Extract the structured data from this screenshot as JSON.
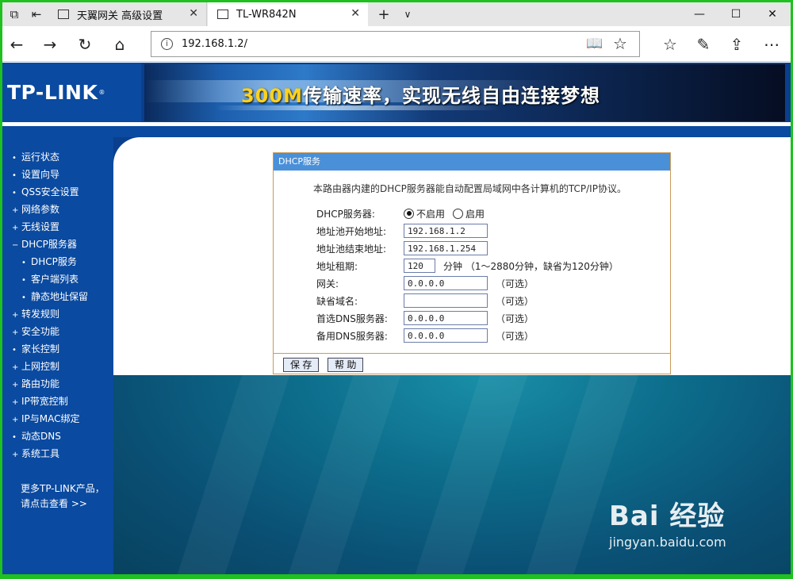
{
  "browser": {
    "tabs": [
      {
        "label": "天翼网关 高级设置"
      },
      {
        "label": "TL-WR842N"
      }
    ],
    "url": "192.168.1.2/"
  },
  "banner": {
    "logo": "TP-LINK",
    "slogan_highlight": "300M",
    "slogan_rest": "传输速率，实现无线自由连接梦想"
  },
  "sidebar": {
    "items": [
      {
        "label": "运行状态",
        "bullet": "•"
      },
      {
        "label": "设置向导",
        "bullet": "•"
      },
      {
        "label": "QSS安全设置",
        "bullet": "•"
      },
      {
        "label": "网络参数",
        "bullet": "+"
      },
      {
        "label": "无线设置",
        "bullet": "+"
      },
      {
        "label": "DHCP服务器",
        "bullet": "−"
      },
      {
        "label": "DHCP服务",
        "bullet": "•"
      },
      {
        "label": "客户端列表",
        "bullet": "•"
      },
      {
        "label": "静态地址保留",
        "bullet": "•"
      },
      {
        "label": "转发规则",
        "bullet": "+"
      },
      {
        "label": "安全功能",
        "bullet": "+"
      },
      {
        "label": "家长控制",
        "bullet": "•"
      },
      {
        "label": "上网控制",
        "bullet": "+"
      },
      {
        "label": "路由功能",
        "bullet": "+"
      },
      {
        "label": "IP带宽控制",
        "bullet": "+"
      },
      {
        "label": "IP与MAC绑定",
        "bullet": "+"
      },
      {
        "label": "动态DNS",
        "bullet": "•"
      },
      {
        "label": "系统工具",
        "bullet": "+"
      }
    ],
    "more_line1": "更多TP-LINK产品，",
    "more_line2": "请点击查看 >>"
  },
  "panel": {
    "title": "DHCP服务",
    "description": "本路由器内建的DHCP服务器能自动配置局域网中各计算机的TCP/IP协议。",
    "server_label": "DHCP服务器:",
    "radio_off": "不启用",
    "radio_on": "启用",
    "selected": "不启用",
    "start_label": "地址池开始地址:",
    "start_value": "192.168.1.2",
    "end_label": "地址池结束地址:",
    "end_value": "192.168.1.254",
    "lease_label": "地址租期:",
    "lease_value": "120",
    "lease_hint": "分钟 （1～2880分钟，缺省为120分钟）",
    "gateway_label": "网关:",
    "gateway_value": "0.0.0.0",
    "domain_label": "缺省域名:",
    "domain_value": "",
    "dns1_label": "首选DNS服务器:",
    "dns1_value": "0.0.0.0",
    "dns2_label": "备用DNS服务器:",
    "dns2_value": "0.0.0.0",
    "optional": "（可选）",
    "save_label": "保 存",
    "help_label": "帮 助"
  },
  "watermark": {
    "brand": "Bai 经验",
    "site": "jingyan.baidu.com"
  }
}
